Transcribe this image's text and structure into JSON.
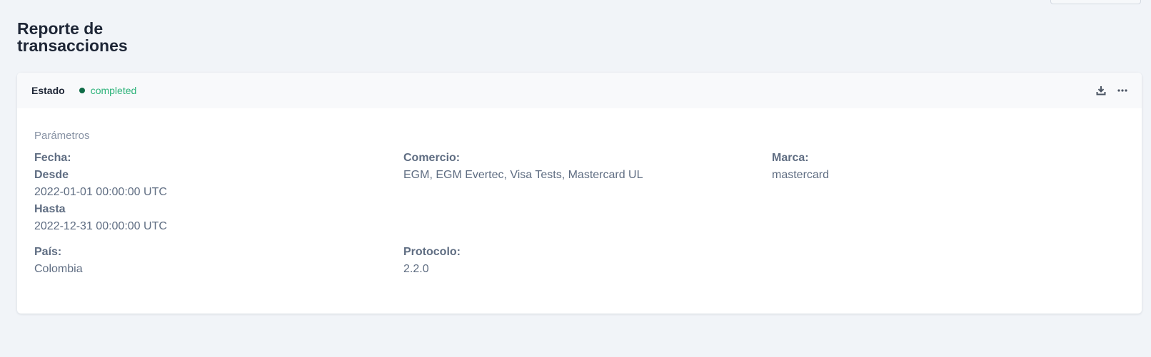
{
  "page": {
    "title": "Reporte de transacciones"
  },
  "status": {
    "label": "Estado",
    "value": "completed",
    "dot_color": "#0f6b47",
    "text_color": "#2db37a"
  },
  "actions": {
    "download_icon": "download-icon",
    "more_icon": "more-horizontal-icon"
  },
  "parameters": {
    "section_title": "Parámetros",
    "fecha": {
      "label": "Fecha:",
      "desde_label": "Desde",
      "desde_value": "2022-01-01 00:00:00 UTC",
      "hasta_label": "Hasta",
      "hasta_value": "2022-12-31 00:00:00 UTC"
    },
    "comercio": {
      "label": "Comercio:",
      "value": "EGM, EGM Evertec, Visa Tests, Mastercard UL"
    },
    "marca": {
      "label": "Marca:",
      "value": "mastercard"
    },
    "pais": {
      "label": "País:",
      "value": "Colombia"
    },
    "protocolo": {
      "label": "Protocolo:",
      "value": "2.2.0"
    }
  }
}
